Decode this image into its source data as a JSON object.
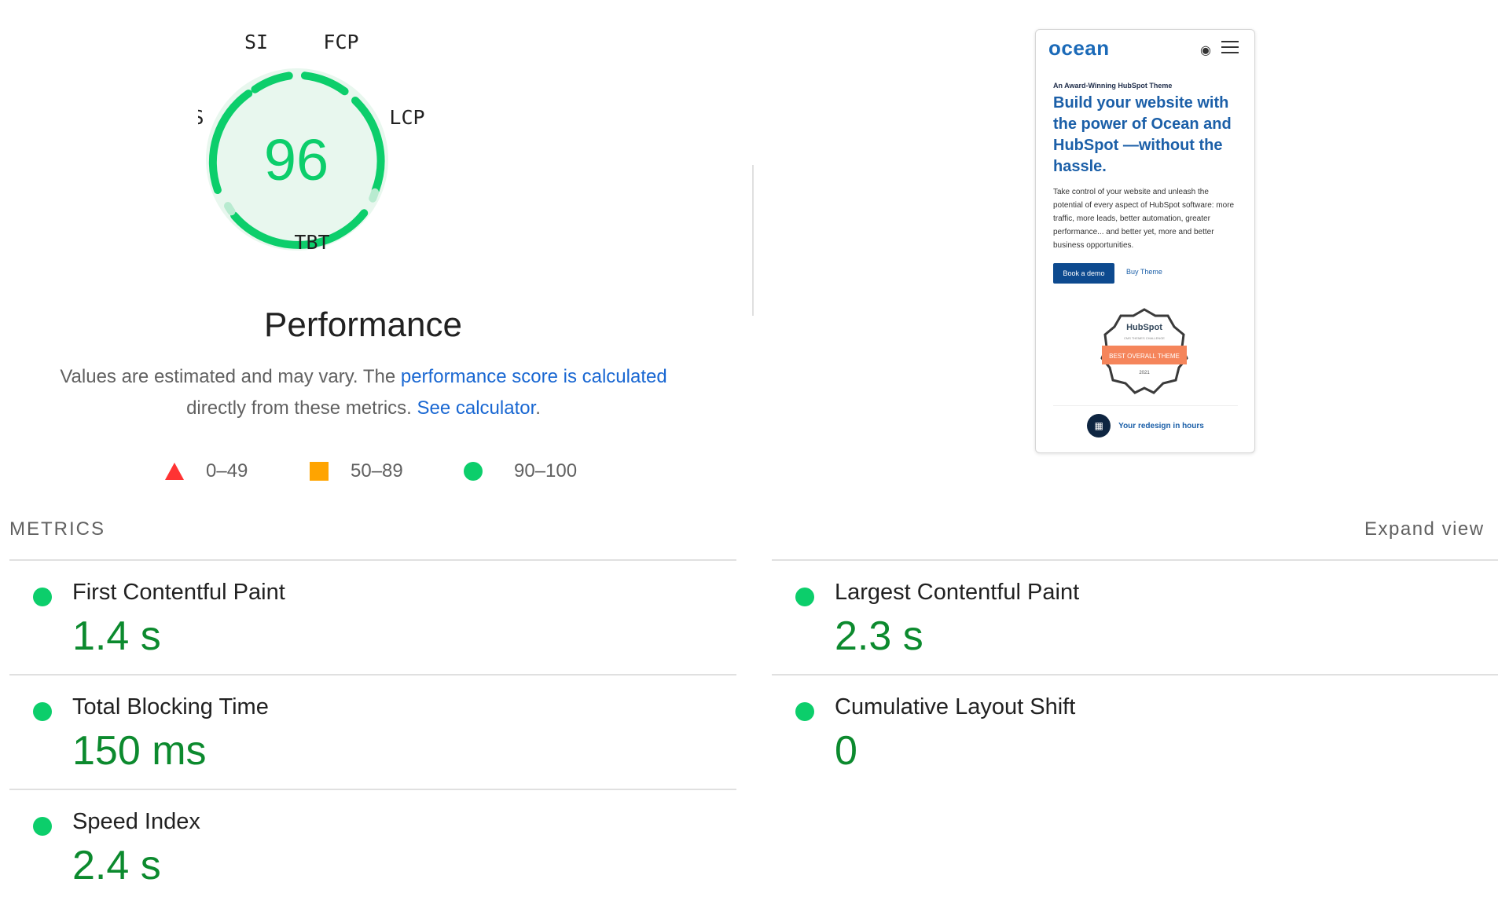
{
  "gauge": {
    "score": "96",
    "labels": {
      "si": "SI",
      "fcp": "FCP",
      "lcp": "LCP",
      "tbt": "TBT",
      "cls": "CLS"
    },
    "color": "#0cce6b"
  },
  "performance": {
    "title": "Performance",
    "desc_prefix": "Values are estimated and may vary. The ",
    "desc_link1": "performance score is calculated",
    "desc_mid": " directly from these metrics. ",
    "desc_link2": "See calculator",
    "desc_suffix": "."
  },
  "legend": [
    {
      "label": "0–49",
      "shape": "triangle",
      "color": "#ff3333"
    },
    {
      "label": "50–89",
      "shape": "square",
      "color": "#ffa400"
    },
    {
      "label": "90–100",
      "shape": "circle",
      "color": "#0cce6b"
    }
  ],
  "preview": {
    "logo": "ocean",
    "globe_icon": "globe-icon",
    "menu_icon": "hamburger-icon",
    "kicker": "An Award-Winning HubSpot Theme",
    "headline": "Build your website with the power of Ocean and HubSpot —without the hassle.",
    "body": "Take control of your website and unleash the potential of every aspect of HubSpot software: more traffic, more leads, better automation, greater performance... and better yet, more and better business opportunities.",
    "primary_btn": "Book a demo",
    "link_btn": "Buy Theme",
    "badge": {
      "brand": "HubSpot",
      "sub": "CMS THEMES CHALLENGE",
      "ribbon": "BEST OVERALL THEME",
      "year": "2021"
    },
    "cta": "Your redesign in hours"
  },
  "metrics_header": "METRICS",
  "expand_view": "Expand view",
  "metrics": [
    {
      "label": "First Contentful Paint",
      "value": "1.4 s",
      "status": "pass"
    },
    {
      "label": "Largest Contentful Paint",
      "value": "2.3 s",
      "status": "pass"
    },
    {
      "label": "Total Blocking Time",
      "value": "150 ms",
      "status": "pass"
    },
    {
      "label": "Cumulative Layout Shift",
      "value": "0",
      "status": "pass"
    },
    {
      "label": "Speed Index",
      "value": "2.4 s",
      "status": "pass"
    }
  ]
}
